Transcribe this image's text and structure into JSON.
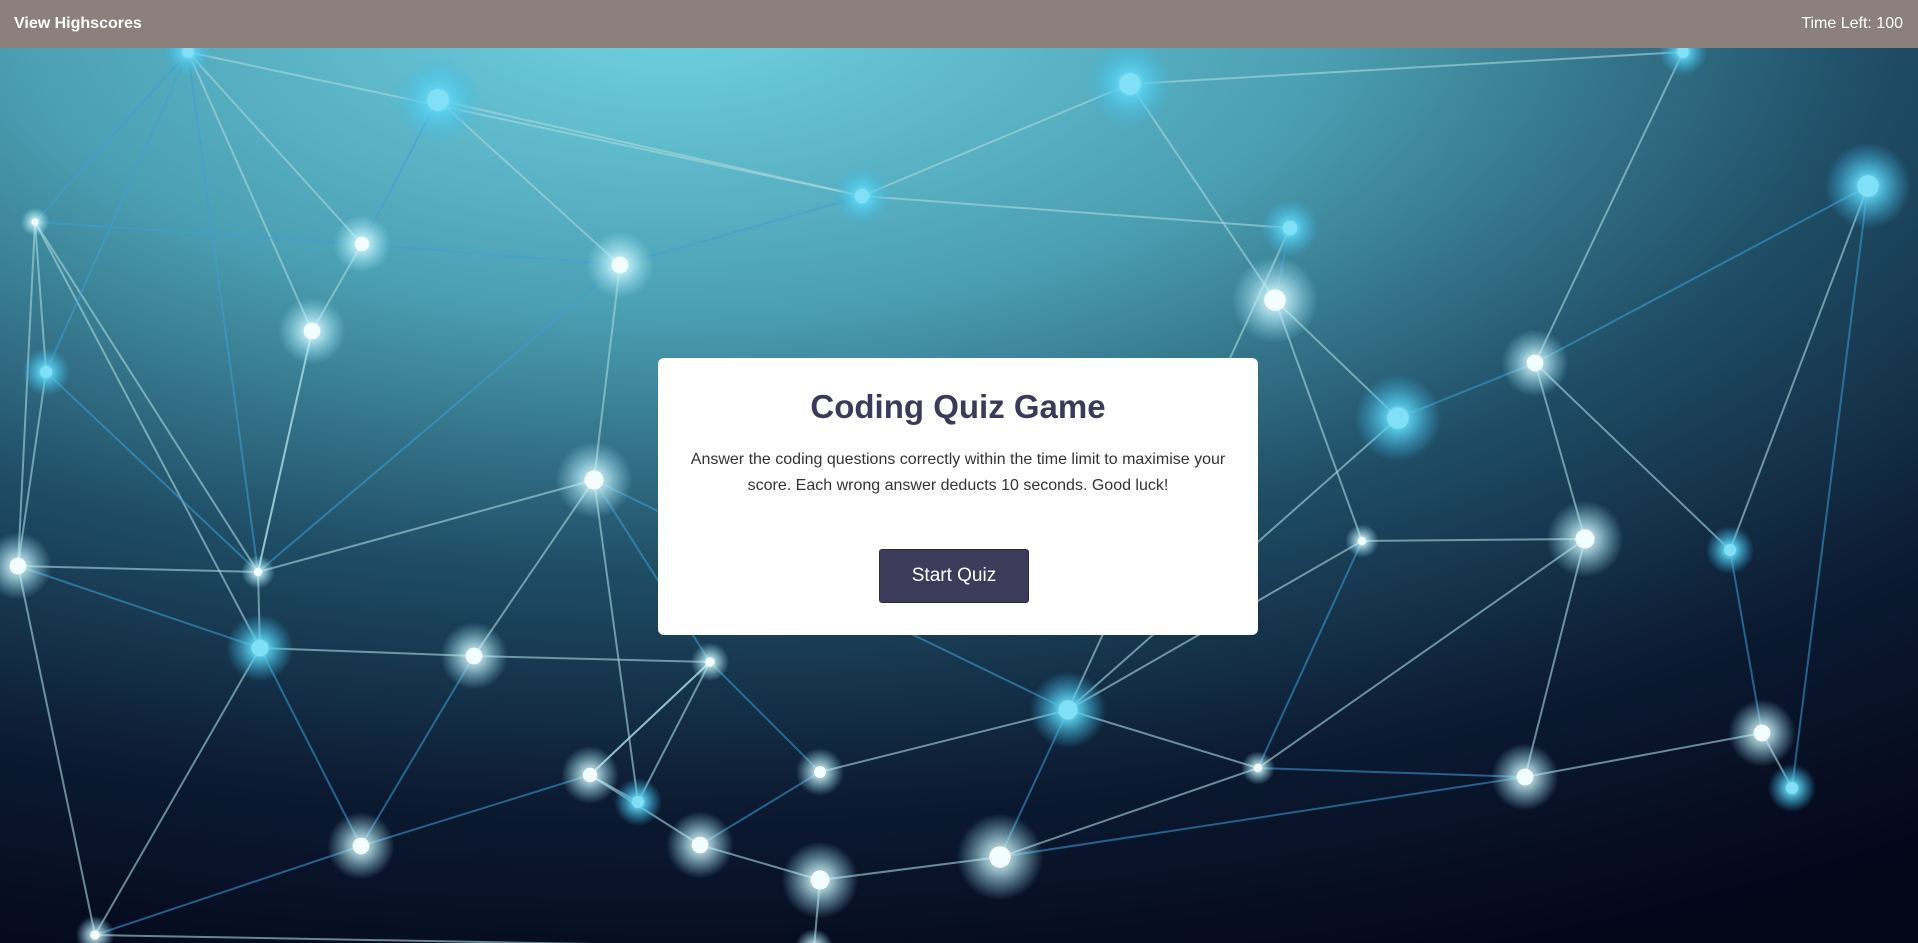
{
  "header": {
    "highscores_link": "View Highscores",
    "timer_text": "Time Left: 100"
  },
  "quiz_intro": {
    "title": "Coding Quiz Game",
    "description": "Answer the coding questions correctly within the time limit to maximise your score. Each wrong answer deducts 10 seconds. Good luck!",
    "start_button": "Start Quiz"
  },
  "colors": {
    "header_bg": "#8b807b",
    "card_bg": "#ffffff",
    "title_color": "#3b3a5a",
    "button_bg": "#3d3b5a",
    "background_top": "#6ecfe0",
    "background_bottom": "#050816"
  }
}
